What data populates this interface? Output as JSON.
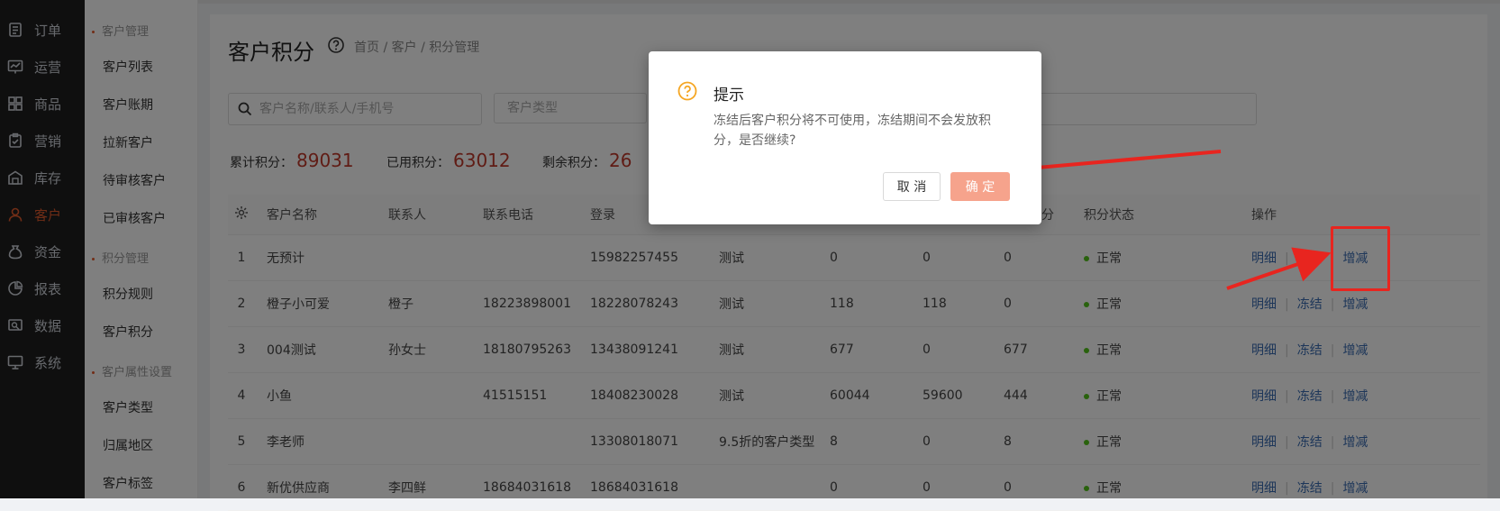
{
  "nav": {
    "items": [
      {
        "label": "订单",
        "icon": "order-icon"
      },
      {
        "label": "运营",
        "icon": "chart-board-icon"
      },
      {
        "label": "商品",
        "icon": "grid-icon"
      },
      {
        "label": "营销",
        "icon": "clipboard-icon"
      },
      {
        "label": "库存",
        "icon": "warehouse-icon"
      },
      {
        "label": "客户",
        "icon": "user-icon"
      },
      {
        "label": "资金",
        "icon": "money-bag-icon"
      },
      {
        "label": "报表",
        "icon": "pie-chart-icon"
      },
      {
        "label": "数据",
        "icon": "data-icon"
      },
      {
        "label": "系统",
        "icon": "monitor-icon"
      }
    ],
    "active_index": 5
  },
  "subnav": {
    "group1": "客户管理",
    "group1_items": [
      "客户列表",
      "客户账期",
      "拉新客户",
      "待审核客户",
      "已审核客户"
    ],
    "group2": "积分管理",
    "group2_items": [
      "积分规则",
      "客户积分"
    ],
    "group3": "客户属性设置",
    "group3_items": [
      "客户类型",
      "归属地区",
      "客户标签"
    ]
  },
  "page": {
    "title": "客户积分",
    "breadcrumb": "首页  /  客户  /  积分管理"
  },
  "filters": {
    "search_placeholder": "客户名称/联系人/手机号",
    "type_placeholder": "客户类型"
  },
  "stats": {
    "total_label": "累计积分：",
    "total_value": "89031",
    "used_label": "已用积分：",
    "used_value": "63012",
    "remain_label": "剩余积分：",
    "remain_value": "26"
  },
  "table": {
    "headers": [
      "客户名称",
      "联系人",
      "联系电话",
      "登录",
      "",
      "",
      "",
      "剩余积分",
      "积分状态",
      "操作"
    ],
    "rows": [
      {
        "idx": "1",
        "name": "无预计",
        "contact": "",
        "phone": "",
        "login": "15982257455",
        "type": "测试",
        "total": "0",
        "used": "0",
        "remain": "0",
        "status": "正常"
      },
      {
        "idx": "2",
        "name": "橙子小可爱",
        "contact": "橙子",
        "phone": "18223898001",
        "login": "18228078243",
        "type": "测试",
        "total": "118",
        "used": "118",
        "remain": "0",
        "status": "正常"
      },
      {
        "idx": "3",
        "name": "004测试",
        "contact": "孙女士",
        "phone": "18180795263",
        "login": "13438091241",
        "type": "测试",
        "total": "677",
        "used": "0",
        "remain": "677",
        "status": "正常"
      },
      {
        "idx": "4",
        "name": "小鱼",
        "contact": "",
        "phone": "41515151",
        "login": "18408230028",
        "type": "测试",
        "total": "60044",
        "used": "59600",
        "remain": "444",
        "status": "正常"
      },
      {
        "idx": "5",
        "name": "李老师",
        "contact": "",
        "phone": "",
        "login": "13308018071",
        "type": "9.5折的客户类型",
        "total": "8",
        "used": "0",
        "remain": "8",
        "status": "正常"
      },
      {
        "idx": "6",
        "name": "新优供应商",
        "contact": "李四鲜",
        "phone": "18684031618",
        "login": "18684031618",
        "type": "",
        "total": "0",
        "used": "0",
        "remain": "0",
        "status": "正常"
      }
    ],
    "ops": [
      "明细",
      "冻结",
      "增减"
    ]
  },
  "dialog": {
    "title": "提示",
    "message": "冻结后客户积分将不可使用，冻结期间不会发放积分，是否继续?",
    "cancel": "取 消",
    "ok": "确 定"
  },
  "colors": {
    "accent": "#e35b2d",
    "link": "#3b6db3",
    "annotation": "#e8251f"
  }
}
